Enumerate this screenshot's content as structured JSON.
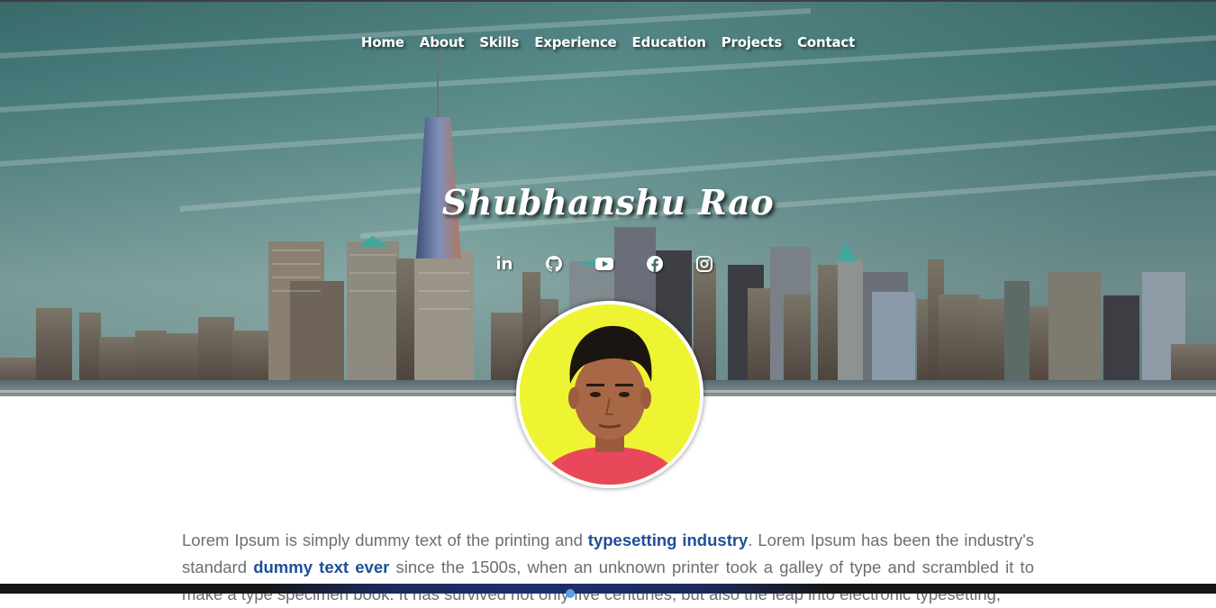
{
  "nav": {
    "items": [
      "Home",
      "About",
      "Skills",
      "Experience",
      "Education",
      "Projects",
      "Contact"
    ]
  },
  "hero": {
    "name": "Shubhanshu Rao"
  },
  "socials": [
    {
      "icon": "linkedin-icon"
    },
    {
      "icon": "github-icon"
    },
    {
      "icon": "youtube-icon"
    },
    {
      "icon": "facebook-icon"
    },
    {
      "icon": "instagram-icon"
    }
  ],
  "about": {
    "t1": "Lorem Ipsum is simply dummy text of the printing and ",
    "b1": "typesetting industry",
    "t2": ". Lorem Ipsum has been the industry's standard ",
    "b2": "dummy text ever",
    "t3": " since the 1500s, when an unknown printer took a galley of type and scrambled it to make a type specimen book. It has survived not only five centuries, but also the leap into electronic typesetting,"
  },
  "colors": {
    "accent": "#1f4f9a",
    "text": "#6b6f73",
    "avatar_bg": "#eef431"
  }
}
